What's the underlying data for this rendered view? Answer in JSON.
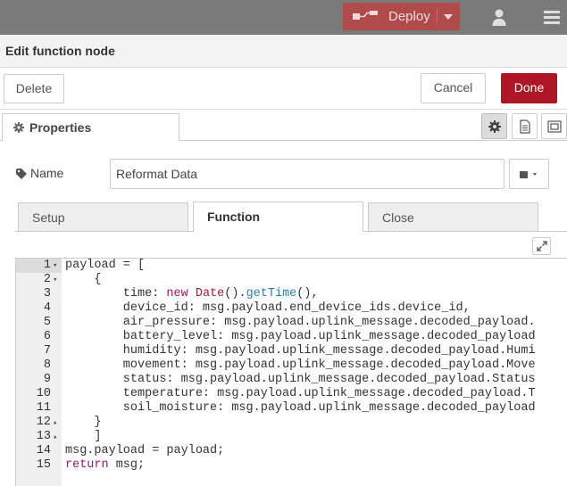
{
  "topbar": {
    "deploy_label": "Deploy",
    "deploy_color": "#b14b4b"
  },
  "tray": {
    "title": "Edit function node",
    "delete_label": "Delete",
    "cancel_label": "Cancel",
    "done_label": "Done",
    "done_color": "#ad1625"
  },
  "tabs": {
    "properties_label": "Properties"
  },
  "form": {
    "name_label": "Name",
    "name_value": "Reformat Data"
  },
  "subtabs": [
    "Setup",
    "Function",
    "Close"
  ],
  "editor": {
    "lines": [
      {
        "n": "1",
        "fold": "▾",
        "html": "payload = ["
      },
      {
        "n": "2",
        "fold": "▾",
        "html": "    {"
      },
      {
        "n": "3",
        "fold": "",
        "html": "        time: <span class=\"kw\">new</span> <span class=\"cls\">Date</span>().<span class=\"fn\">getTime</span>(),"
      },
      {
        "n": "4",
        "fold": "",
        "html": "        device_id: msg.payload.end_device_ids.device_id,"
      },
      {
        "n": "5",
        "fold": "",
        "html": "        air_pressure: msg.payload.uplink_message.decoded_payload."
      },
      {
        "n": "6",
        "fold": "",
        "html": "        battery_level: msg.payload.uplink_message.decoded_payload"
      },
      {
        "n": "7",
        "fold": "",
        "html": "        humidity: msg.payload.uplink_message.decoded_payload.Humi"
      },
      {
        "n": "8",
        "fold": "",
        "html": "        movement: msg.payload.uplink_message.decoded_payload.Move"
      },
      {
        "n": "9",
        "fold": "",
        "html": "        status: msg.payload.uplink_message.decoded_payload.Status"
      },
      {
        "n": "10",
        "fold": "",
        "html": "        temperature: msg.payload.uplink_message.decoded_payload.T"
      },
      {
        "n": "11",
        "fold": "",
        "html": "        soil_moisture: msg.payload.uplink_message.decoded_payload"
      },
      {
        "n": "12",
        "fold": "▴",
        "html": "    }"
      },
      {
        "n": "13",
        "fold": "▴",
        "html": "    ]"
      },
      {
        "n": "14",
        "fold": "",
        "html": "msg.payload = payload;"
      },
      {
        "n": "15",
        "fold": "",
        "html": "<span class=\"kw\">return</span> msg;"
      }
    ]
  },
  "icons": {
    "deploy": "flow-icon",
    "user": "user-icon",
    "menu": "hamburger-menu-icon",
    "settings": "gear-icon",
    "description": "document-icon",
    "appearance": "node-appearance-icon",
    "name": "tag-icon",
    "icon_select": "book-icon",
    "expand": "expand-icon"
  }
}
